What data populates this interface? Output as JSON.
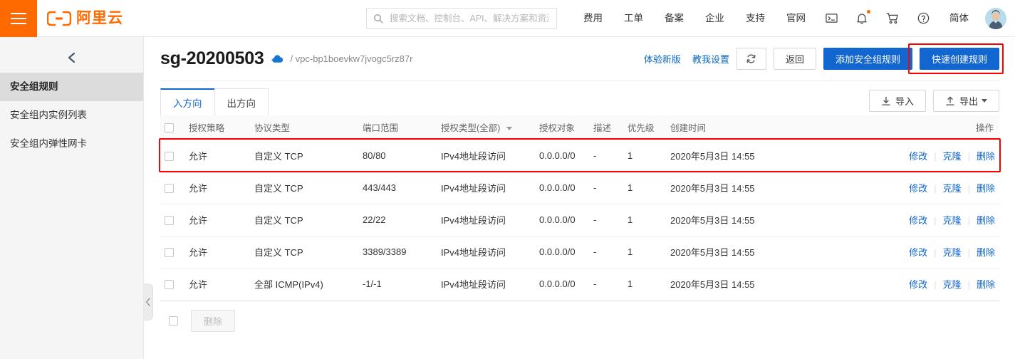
{
  "topnav": {
    "menu_icon": "hamburger-icon",
    "logo_text": "阿里云",
    "search": {
      "icon": "search-icon",
      "placeholder": "搜索文档、控制台、API、解决方案和资源",
      "value": ""
    },
    "links": [
      "费用",
      "工单",
      "备案",
      "企业",
      "支持",
      "官网"
    ],
    "icons": [
      {
        "name": "terminal-icon",
        "badge": false
      },
      {
        "name": "bell-icon",
        "badge": true
      },
      {
        "name": "cart-icon",
        "badge": false
      },
      {
        "name": "help-icon",
        "badge": false
      }
    ],
    "language": "简体",
    "avatar": "user-avatar"
  },
  "sidebar": {
    "collapse_icon": "chevron-left-icon",
    "items": [
      {
        "label": "安全组规则",
        "active": true
      },
      {
        "label": "安全组内实例列表",
        "active": false
      },
      {
        "label": "安全组内弹性网卡",
        "active": false
      }
    ],
    "handle_icon": "chevron-left-icon"
  },
  "page_header": {
    "title": "sg-20200503",
    "cloud_icon": "cloud-icon",
    "vpc_path": "/ vpc-bp1boevkw7jvogc5rz87r",
    "links": [
      "体验新版",
      "教我设置"
    ],
    "refresh_icon": "refresh-icon",
    "back_button": "返回",
    "add_rule_button": "添加安全组规则",
    "quick_create_button": "快速创建规则"
  },
  "tabs": [
    {
      "label": "入方向",
      "active": true
    },
    {
      "label": "出方向",
      "active": false
    }
  ],
  "toolbar": {
    "import_label": "导入",
    "import_icon": "download-icon",
    "export_label": "导出",
    "export_icon": "upload-icon",
    "export_caret": "chevron-down-icon"
  },
  "table": {
    "columns": [
      "授权策略",
      "协议类型",
      "端口范围",
      "授权类型(全部)",
      "授权对象",
      "描述",
      "优先级",
      "创建时间",
      "操作"
    ],
    "auth_type_has_filter": true,
    "rows": [
      {
        "policy": "允许",
        "protocol": "自定义 TCP",
        "port": "80/80",
        "auth_type": "IPv4地址段访问",
        "auth_object": "0.0.0.0/0",
        "description": "-",
        "priority": "1",
        "created": "2020年5月3日 14:55",
        "highlighted": true
      },
      {
        "policy": "允许",
        "protocol": "自定义 TCP",
        "port": "443/443",
        "auth_type": "IPv4地址段访问",
        "auth_object": "0.0.0.0/0",
        "description": "-",
        "priority": "1",
        "created": "2020年5月3日 14:55",
        "highlighted": false
      },
      {
        "policy": "允许",
        "protocol": "自定义 TCP",
        "port": "22/22",
        "auth_type": "IPv4地址段访问",
        "auth_object": "0.0.0.0/0",
        "description": "-",
        "priority": "1",
        "created": "2020年5月3日 14:55",
        "highlighted": false
      },
      {
        "policy": "允许",
        "protocol": "自定义 TCP",
        "port": "3389/3389",
        "auth_type": "IPv4地址段访问",
        "auth_object": "0.0.0.0/0",
        "description": "-",
        "priority": "1",
        "created": "2020年5月3日 14:55",
        "highlighted": false
      },
      {
        "policy": "允许",
        "protocol": "全部 ICMP(IPv4)",
        "port": "-1/-1",
        "auth_type": "IPv4地址段访问",
        "auth_object": "0.0.0.0/0",
        "description": "-",
        "priority": "1",
        "created": "2020年5月3日 14:55",
        "highlighted": false
      }
    ],
    "row_actions": [
      "修改",
      "克隆",
      "删除"
    ],
    "footer_delete_label": "删除"
  },
  "colors": {
    "brand_orange": "#ff6a00",
    "primary_blue": "#1166cf",
    "link_blue": "#0a66c2",
    "highlight_red": "#ff0000",
    "sidebar_bg": "#f5f5f5",
    "sidebar_active_bg": "#dcdcdc",
    "table_header_bg": "#fafafa"
  }
}
